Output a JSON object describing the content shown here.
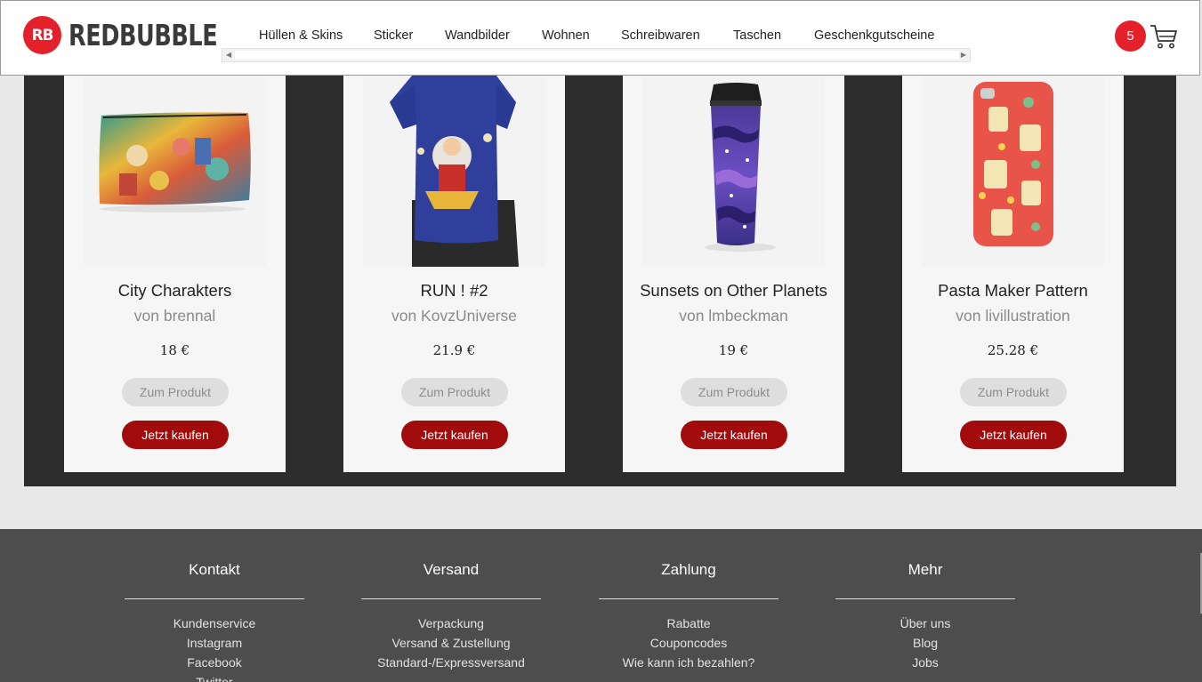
{
  "header": {
    "logo_mark": "RB",
    "logo_text": "REDBUBBLE",
    "nav": [
      "Hüllen & Skins",
      "Sticker",
      "Wandbilder",
      "Wohnen",
      "Schreibwaren",
      "Taschen",
      "Geschenkgutscheine"
    ],
    "cart_count": "5"
  },
  "products": [
    {
      "title": "City Charakters",
      "artist": "von brennal",
      "price": "18 €",
      "view_label": "Zum Produkt",
      "buy_label": "Jetzt kaufen"
    },
    {
      "title": "RUN ! #2",
      "artist": "von KovzUniverse",
      "price": "21.9 €",
      "view_label": "Zum Produkt",
      "buy_label": "Jetzt kaufen"
    },
    {
      "title": "Sunsets on Other Planets",
      "artist": "von lmbeckman",
      "price": "19 €",
      "view_label": "Zum Produkt",
      "buy_label": "Jetzt kaufen"
    },
    {
      "title": "Pasta Maker Pattern",
      "artist": "von livillustration",
      "price": "25.28 €",
      "view_label": "Zum Produkt",
      "buy_label": "Jetzt kaufen"
    }
  ],
  "footer": {
    "columns": [
      {
        "heading": "Kontakt",
        "links": [
          "Kundenservice",
          "Instagram",
          "Facebook",
          "Twitter"
        ]
      },
      {
        "heading": "Versand",
        "links": [
          "Verpackung",
          "Versand & Zustellung",
          "Standard-/Expressversand"
        ]
      },
      {
        "heading": "Zahlung",
        "links": [
          "Rabatte",
          "Couponcodes",
          "Wie kann ich bezahlen?"
        ]
      },
      {
        "heading": "Mehr",
        "links": [
          "Über uns",
          "Blog",
          "Jobs"
        ]
      }
    ]
  },
  "colors": {
    "brand_red": "#e4202b",
    "buy_button": "#a10b0b",
    "band_bg": "#2d2d2d",
    "footer_bg": "#4d4d4d"
  }
}
